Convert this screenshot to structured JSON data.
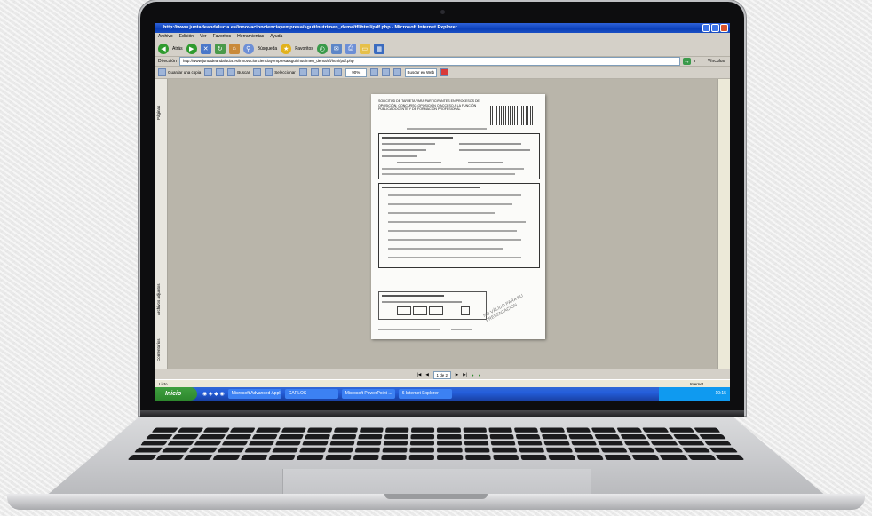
{
  "window": {
    "title": "http://www.juntadeandalucia.es/innovacioncienciayempresa/sguit/nutrimen_dema/tfl/html/pdf.php - Microsoft Internet Explorer"
  },
  "menu": [
    "Archivo",
    "Edición",
    "Ver",
    "Favoritos",
    "Herramientas",
    "Ayuda"
  ],
  "toolbar": {
    "back_label": "Atrás",
    "search_label": "Búsqueda",
    "favorites_label": "Favoritos"
  },
  "address": {
    "label": "Dirección",
    "url": "http://www.juntadeandalucia.es/innovacioncienciayempresa/sguit/nutrimen_dema/tfl/html/pdf.php",
    "go_label": "Ir",
    "links_label": "Vínculos"
  },
  "pdf_toolbar": {
    "save_copy_label": "Guardar una copia",
    "search_label": "Buscar",
    "select_label": "Seleccionar",
    "zoom_value": "90%",
    "search_web_placeholder": "Buscar en Web"
  },
  "sidebar": {
    "tabs": [
      "Páginas",
      "Archivos adjuntos",
      "Comentarios"
    ]
  },
  "document": {
    "heading": "SOLICITUD DE TARJETA PARA PARTICIPANTES EN PROCESOS DE OPOSICIÓN, CONCURSO-OPOSICIÓN O ACCESO A LA FUNCIÓN PÚBLICA DOCENTE Y DE FORMACIÓN PROFESIONAL",
    "stamp": "NO VÁLIDO PARA SU PRESENTACIÓN"
  },
  "navigation": {
    "page_indicator": "1 de 2"
  },
  "status": {
    "left": "Listo",
    "zone": "Internet"
  },
  "taskbar": {
    "start_label": "Inicio",
    "tasks": [
      "Microsoft Advanced Appl...",
      "CARLOS",
      "Microsoft PowerPoint ...",
      "6 Internet Explorer"
    ],
    "clock": "10:15"
  }
}
